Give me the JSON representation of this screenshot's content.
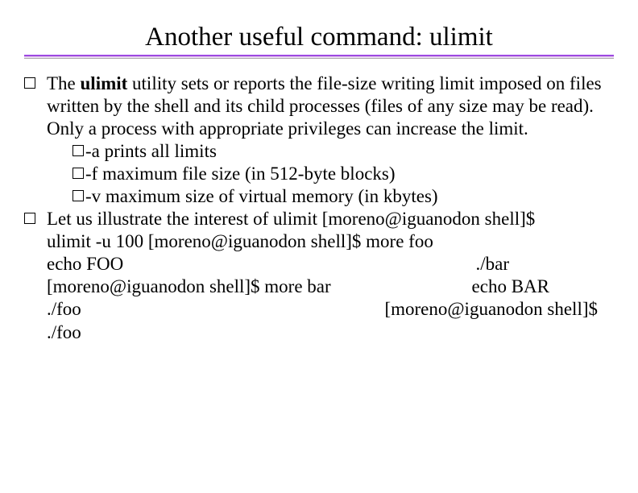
{
  "title": "Another useful command: ulimit",
  "p1_pre": "The ",
  "p1_cmd": "ulimit",
  "p1_post": " utility sets or  reports  the  file-size  writing limit imposed  on  files written by the shell and its child processes (files of any size may be read).  Only  a  process with appropriate privileges can increase the limit.",
  "sub": [
    {
      "flag": "-a",
      "desc": " prints all limits"
    },
    {
      "flag": "-f",
      "desc": " maximum file size (in 512-byte blocks)"
    },
    {
      "flag": "-v",
      "desc": " maximum size of virtual memory (in kbytes)"
    }
  ],
  "p2_lead": "Let us illustrate the interest of ulimit ",
  "lines": {
    "l1_left": "[moreno@iguanodon shell]$",
    "l2_left": "ulimit -u 100 [moreno@iguanodon shell]$ more foo",
    "l3_left": "echo FOO",
    "l3_right": "./bar",
    "l4_left": "[moreno@iguanodon shell]$ more bar",
    "l4_right": "echo BAR",
    "l5_left": "./foo",
    "l5_right": "[moreno@iguanodon shell]$",
    "l6_left": "./foo"
  }
}
